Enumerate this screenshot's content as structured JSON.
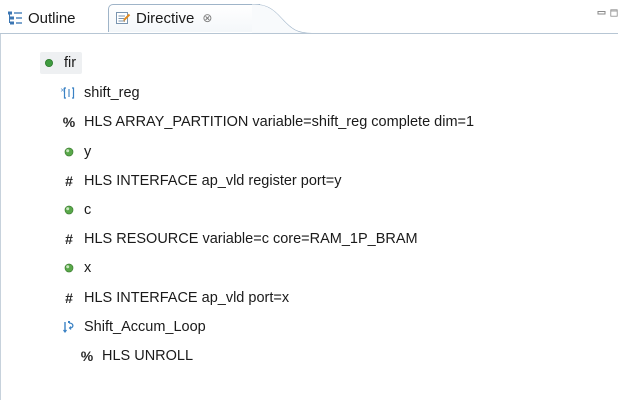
{
  "tabs": {
    "outline_label": "Outline",
    "directive_label": "Directive",
    "close_glyph": "⊗"
  },
  "tree": {
    "root": {
      "label": "fir",
      "icon": "function-icon"
    },
    "items": [
      {
        "label": "shift_reg",
        "icon": "array-variable-icon"
      },
      {
        "label": "HLS ARRAY_PARTITION variable=shift_reg complete dim=1",
        "icon": "percent-directive-icon",
        "glyph": "%"
      },
      {
        "label": "y",
        "icon": "port-icon"
      },
      {
        "label": "HLS INTERFACE ap_vld register port=y",
        "icon": "hash-directive-icon",
        "glyph": "#"
      },
      {
        "label": "c",
        "icon": "port-icon"
      },
      {
        "label": "HLS RESOURCE variable=c core=RAM_1P_BRAM",
        "icon": "hash-directive-icon",
        "glyph": "#"
      },
      {
        "label": "x",
        "icon": "port-icon"
      },
      {
        "label": "HLS INTERFACE ap_vld port=x",
        "icon": "hash-directive-icon",
        "glyph": "#"
      },
      {
        "label": "Shift_Accum_Loop",
        "icon": "loop-icon"
      },
      {
        "label": "HLS UNROLL",
        "icon": "percent-directive-icon",
        "glyph": "%"
      }
    ]
  },
  "colors": {
    "function_green": "#3f9b3f",
    "port_green": "#59a84a",
    "loop_blue": "#3b82c4",
    "tab_border": "#9fb4c8"
  }
}
